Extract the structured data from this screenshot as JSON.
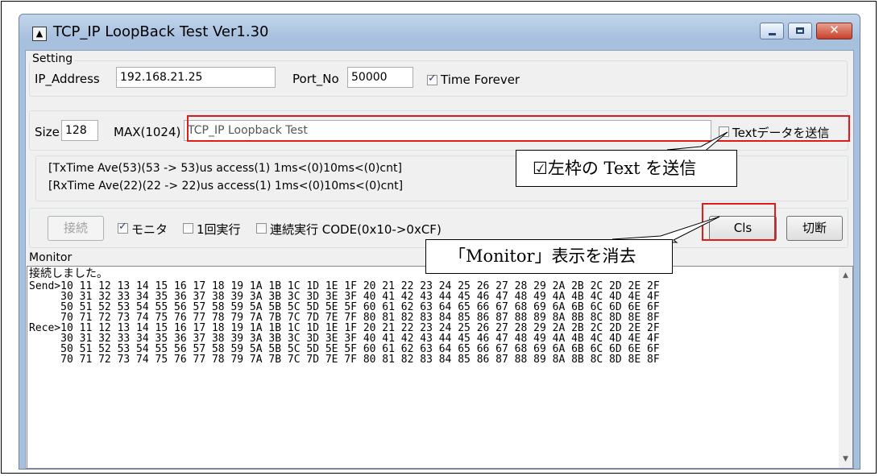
{
  "window": {
    "title": "TCP_IP LoopBack Test Ver1.30",
    "app_icon": "network-icon",
    "controls": {
      "minimize": "minimize-icon",
      "maximize": "maximize-icon",
      "close": "close-icon",
      "close_glyph": "✕"
    }
  },
  "setting": {
    "group_label": "Setting",
    "ip_label": "IP_Address",
    "ip_value": "192.168.21.25",
    "port_label": "Port_No",
    "port_value": "50000",
    "time_forever_label": "Time Forever",
    "time_forever_checked": true
  },
  "data": {
    "size_label": "Size",
    "size_value": "128",
    "max_label": "MAX(1024)",
    "text_value": "TCP_IP Loopback Test",
    "send_text_label": "Textデータを送信",
    "send_text_checked": false
  },
  "stats": {
    "tx": "[TxTime Ave(53)(53 -> 53)us access(1) 1ms<(0)10ms<(0)cnt]",
    "rx": "[RxTime Ave(22)(22 -> 22)us access(1) 1ms<(0)10ms<(0)cnt]"
  },
  "controls": {
    "connect_label": "接続",
    "monitor_label": "モニタ",
    "monitor_checked": true,
    "once_label": "1回実行",
    "once_checked": false,
    "continuous_label": "連続実行 CODE(0x10->0xCF)",
    "continuous_checked": false,
    "cls_label": "Cls",
    "disconnect_label": "切断"
  },
  "monitor": {
    "group_label": "Monitor",
    "lines": [
      "接続しました。",
      "Send>10 11 12 13 14 15 16 17 18 19 1A 1B 1C 1D 1E 1F 20 21 22 23 24 25 26 27 28 29 2A 2B 2C 2D 2E 2F",
      "     30 31 32 33 34 35 36 37 38 39 3A 3B 3C 3D 3E 3F 40 41 42 43 44 45 46 47 48 49 4A 4B 4C 4D 4E 4F",
      "     50 51 52 53 54 55 56 57 58 59 5A 5B 5C 5D 5E 5F 60 61 62 63 64 65 66 67 68 69 6A 6B 6C 6D 6E 6F",
      "     70 71 72 73 74 75 76 77 78 79 7A 7B 7C 7D 7E 7F 80 81 82 83 84 85 86 87 88 89 8A 8B 8C 8D 8E 8F",
      "Rece>10 11 12 13 14 15 16 17 18 19 1A 1B 1C 1D 1E 1F 20 21 22 23 24 25 26 27 28 29 2A 2B 2C 2D 2E 2F",
      "     30 31 32 33 34 35 36 37 38 39 3A 3B 3C 3D 3E 3F 40 41 42 43 44 45 46 47 48 49 4A 4B 4C 4D 4E 4F",
      "     50 51 52 53 54 55 56 57 58 59 5A 5B 5C 5D 5E 5F 60 61 62 63 64 65 66 67 68 69 6A 6B 6C 6D 6E 6F",
      "     70 71 72 73 74 75 76 77 78 79 7A 7B 7C 7D 7E 7F 80 81 82 83 84 85 86 87 88 89 8A 8B 8C 8D 8E 8F"
    ],
    "scroll_up": "▲",
    "scroll_down": "▼"
  },
  "annotations": {
    "text_callout": "☑左枠の Text を送信",
    "cls_callout": "「Monitor」表示を消去",
    "highlight_color": "#e01b1b"
  }
}
